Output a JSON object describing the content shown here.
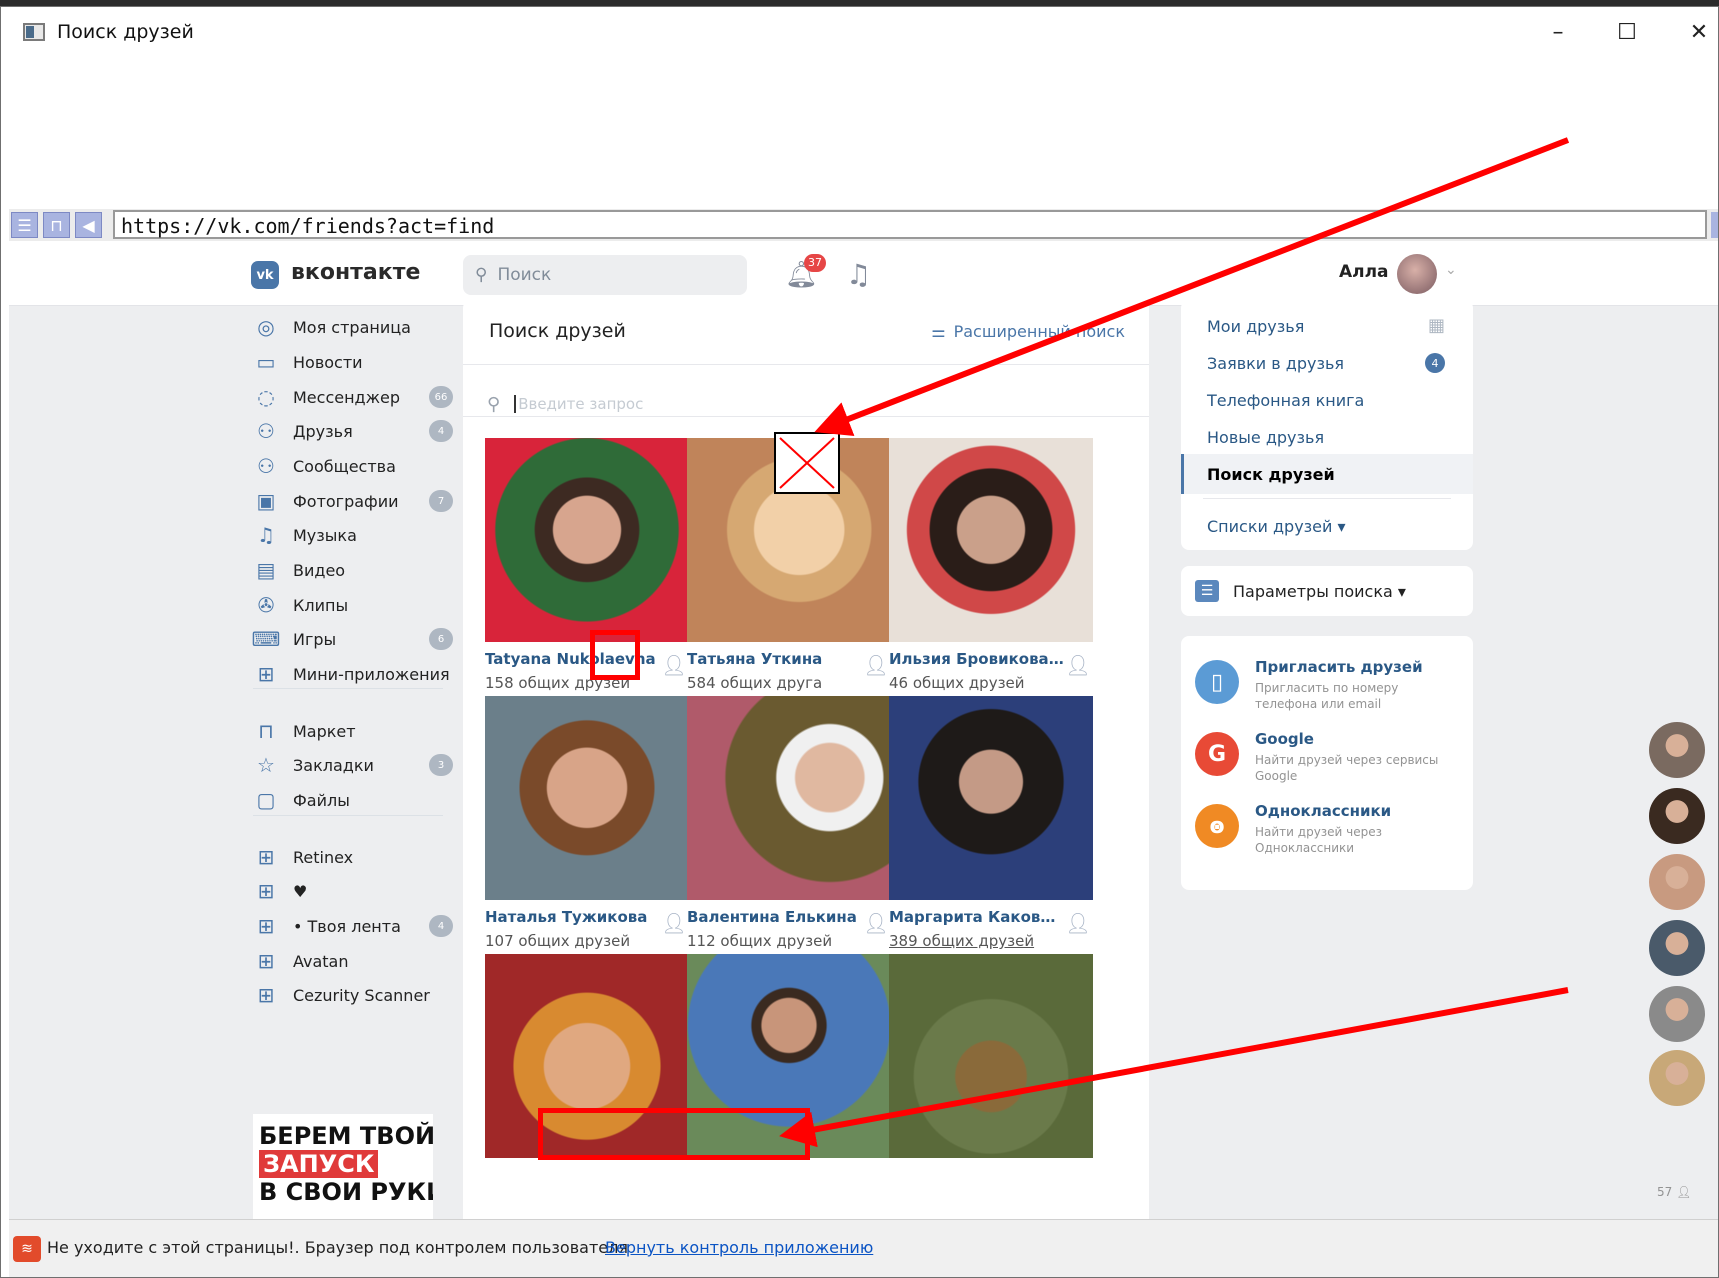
{
  "window": {
    "title": "Поиск друзей",
    "minimize": "–",
    "maximize": "☐",
    "close": "✕"
  },
  "address": {
    "url": "https://vk.com/friends?act=find"
  },
  "header": {
    "logo_mark": "vk",
    "logo_text": "вконтакте",
    "search_placeholder": "Поиск",
    "notifications": "37",
    "user_name": "Алла"
  },
  "left_nav": [
    {
      "label": "Моя страница",
      "icon": "profile-icon",
      "badge": ""
    },
    {
      "label": "Новости",
      "icon": "news-icon",
      "badge": ""
    },
    {
      "label": "Мессенджер",
      "icon": "messenger-icon",
      "badge": "66"
    },
    {
      "label": "Друзья",
      "icon": "friends-icon",
      "badge": "4"
    },
    {
      "label": "Сообщества",
      "icon": "communities-icon",
      "badge": ""
    },
    {
      "label": "Фотографии",
      "icon": "photos-icon",
      "badge": "7"
    },
    {
      "label": "Музыка",
      "icon": "music-icon",
      "badge": ""
    },
    {
      "label": "Видео",
      "icon": "video-icon",
      "badge": ""
    },
    {
      "label": "Клипы",
      "icon": "clips-icon",
      "badge": ""
    },
    {
      "label": "Игры",
      "icon": "games-icon",
      "badge": "6"
    },
    {
      "label": "Мини-приложения",
      "icon": "mini-apps-icon",
      "badge": ""
    },
    {
      "label": "Маркет",
      "icon": "market-icon",
      "badge": ""
    },
    {
      "label": "Закладки",
      "icon": "bookmarks-icon",
      "badge": "3"
    },
    {
      "label": "Файлы",
      "icon": "files-icon",
      "badge": ""
    },
    {
      "label": "Retinex",
      "icon": "app-icon",
      "badge": ""
    },
    {
      "label": "♥",
      "icon": "app-icon",
      "badge": ""
    },
    {
      "label": "• Твоя лента",
      "icon": "app-icon",
      "badge": "4"
    },
    {
      "label": "Avatan",
      "icon": "app-icon",
      "badge": ""
    },
    {
      "label": "Cezurity Scanner",
      "icon": "app-icon",
      "badge": ""
    }
  ],
  "ad": {
    "line1": "БЕРЕМ ТВОЙ",
    "line2": "ЗАПУСК",
    "line3": "В СВОИ РУКИ"
  },
  "main": {
    "title": "Поиск друзей",
    "advanced_search": "Расширенный поиск",
    "query_placeholder": "Введите запрос",
    "people": [
      {
        "name": "Tatyana Nukolaevna",
        "mutual": "158 общих друзей"
      },
      {
        "name": "Татьяна Уткина",
        "mutual": "584 общих друга"
      },
      {
        "name": "Ильзия Бровикова-Ю...",
        "mutual": "46 общих друзей"
      },
      {
        "name": "Наталья Тужикова",
        "mutual": "107 общих друзей"
      },
      {
        "name": "Валентина Елькина",
        "mutual": "112 общих друзей"
      },
      {
        "name": "Маргарита Каковкина",
        "mutual": "389 общих друзей"
      },
      {
        "name": "",
        "mutual": ""
      },
      {
        "name": "",
        "mutual": ""
      },
      {
        "name": "",
        "mutual": ""
      }
    ]
  },
  "right_menu": [
    {
      "label": "Мои друзья"
    },
    {
      "label": "Заявки в друзья",
      "badge": "4"
    },
    {
      "label": "Телефонная книга"
    },
    {
      "label": "Новые друзья"
    },
    {
      "label": "Поиск друзей"
    },
    {
      "label": "Списки друзей ▾"
    }
  ],
  "search_params": {
    "label": "Параметры поиска ▾"
  },
  "invite": [
    {
      "title": "Пригласить друзей",
      "desc": "Пригласить по номеру телефона или email",
      "color": "#5b9bd5",
      "icon": "phone-icon"
    },
    {
      "title": "Google",
      "desc": "Найти друзей через сервисы Google",
      "color": "#e84a36",
      "icon": "google-icon"
    },
    {
      "title": "Одноклассники",
      "desc": "Найти друзей через Одноклассники",
      "color": "#f08a24",
      "icon": "ok-icon"
    }
  ],
  "online_count": "57",
  "status": {
    "text": "Не уходите с этой страницы!. Браузер под контролем пользователя",
    "link": "Вернуть контроль приложению"
  }
}
